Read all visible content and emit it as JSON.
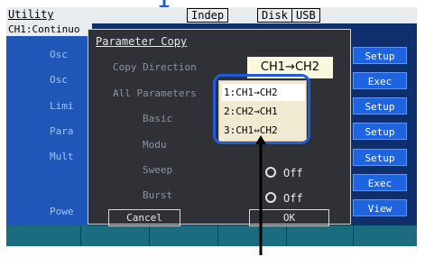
{
  "header": {
    "title": "Utility",
    "indep": "Indep",
    "disk": "Disk",
    "usb": "USB",
    "channel": "CH1:Continuo"
  },
  "left_labels": [
    "Osc",
    "Osc",
    "Limi",
    "Para",
    "Mult",
    "Powe"
  ],
  "right_buttons": [
    "Setup",
    "Exec",
    "Setup",
    "Setup",
    "Setup",
    "Exec",
    "View"
  ],
  "dialog": {
    "title": "Parameter Copy",
    "copy_direction_label": "Copy Direction",
    "copy_direction_value": "CH1→CH2",
    "all_params_label": "All Parameters",
    "basic_label": "Basic",
    "modu_label": "Modu",
    "sweep_label": "Sweep",
    "burst_label": "Burst",
    "sweep_value": "Off",
    "burst_value": "Off",
    "cancel": "Cancel",
    "ok": "OK"
  },
  "dropdown": {
    "options": [
      "1:CH1→CH2",
      "2:CH2→CH1",
      "3:CH1⇔CH2"
    ],
    "selected": 0
  },
  "colors": {
    "screen_bg": "#0e2f6c",
    "left_col": "#1f56b8",
    "right_button": "#1f64df",
    "dialog_bg": "#2f3137",
    "highlight": "#1f5bdc",
    "value_box": "#fbf8df"
  }
}
